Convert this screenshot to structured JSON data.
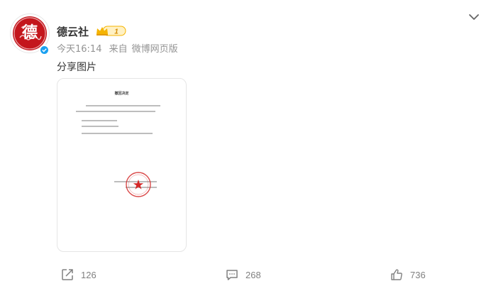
{
  "account": {
    "name": "德云社",
    "avatar_text": "德",
    "badge_level": "1",
    "verified": true
  },
  "meta": {
    "time": "今天16:14",
    "from_label": "来自",
    "source": "微博网页版"
  },
  "post": {
    "text": "分享图片",
    "document": {
      "title": "撤回决定"
    }
  },
  "actions": {
    "share_count": "126",
    "comment_count": "268",
    "like_count": "736"
  },
  "colors": {
    "brand_red": "#c4161c",
    "verified_blue": "#1aa0f0",
    "badge_gold": "#f5b400"
  }
}
